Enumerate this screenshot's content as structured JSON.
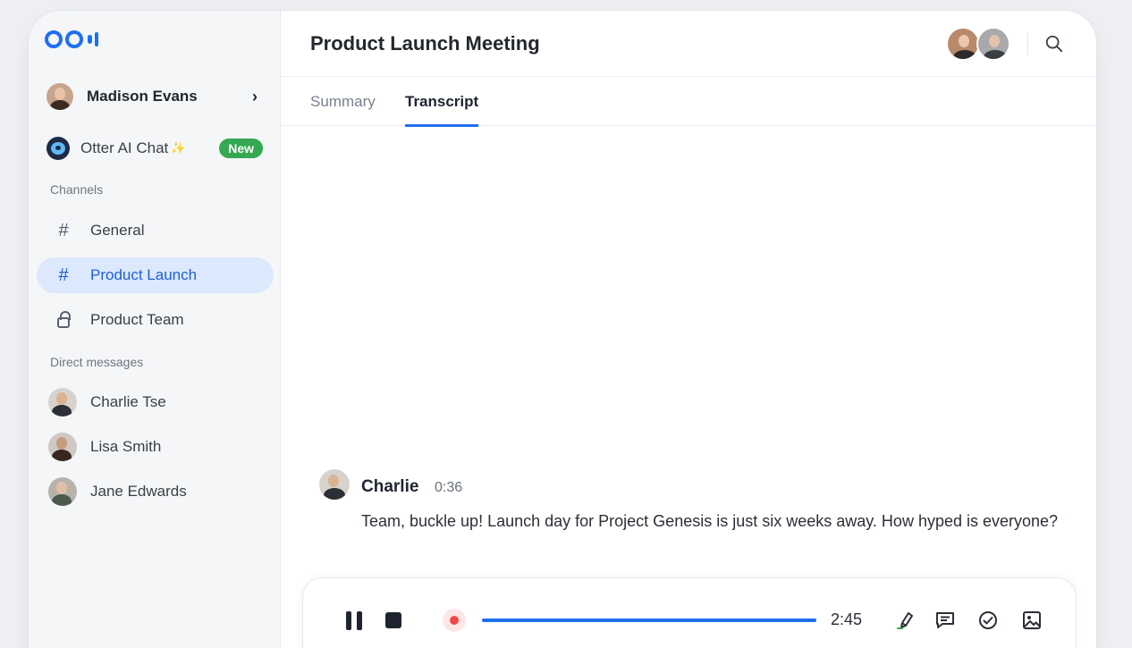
{
  "sidebar": {
    "user": {
      "name": "Madison Evans"
    },
    "otter_chat": {
      "label": "Otter AI Chat",
      "sparkle": "✨",
      "badge": "New"
    },
    "channels_label": "Channels",
    "channels": [
      {
        "label": "General",
        "icon": "hash-icon"
      },
      {
        "label": "Product Launch",
        "icon": "hash-icon",
        "active": true
      },
      {
        "label": "Product Team",
        "icon": "lock-icon"
      }
    ],
    "dm_label": "Direct messages",
    "direct_messages": [
      {
        "label": "Charlie Tse"
      },
      {
        "label": "Lisa Smith"
      },
      {
        "label": "Jane Edwards"
      }
    ]
  },
  "header": {
    "title": "Product Launch Meeting"
  },
  "tabs": [
    {
      "label": "Summary",
      "active": false
    },
    {
      "label": "Transcript",
      "active": true
    }
  ],
  "message": {
    "speaker": "Charlie",
    "time": "0:36",
    "text": "Team, buckle up! Launch day for Project Genesis is just six weeks away. How hyped is everyone?"
  },
  "player": {
    "elapsed": "2:45",
    "progress_fraction": 1.0
  },
  "colors": {
    "accent": "#1f6ff2",
    "active_nav_bg": "#dce8fb",
    "badge_green": "#34a853",
    "record_red": "#f04848"
  }
}
